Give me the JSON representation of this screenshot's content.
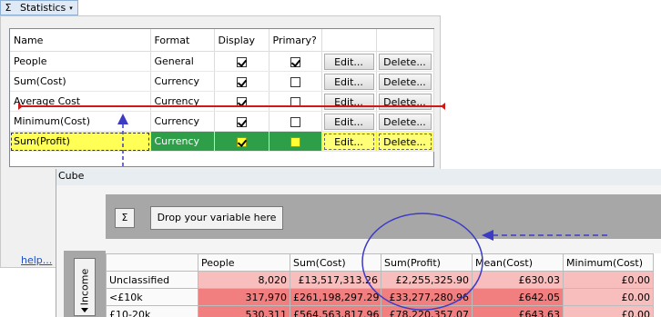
{
  "statistics_button": {
    "label": "Statistics",
    "sigma": "Σ",
    "caret": "▾"
  },
  "stats_table": {
    "headers": [
      "Name",
      "Format",
      "Display",
      "Primary?",
      "",
      ""
    ],
    "edit_label": "Edit...",
    "delete_label": "Delete...",
    "rows": [
      {
        "name": "People",
        "format": "General",
        "display": true,
        "primary": true
      },
      {
        "name": "Sum(Cost)",
        "format": "Currency",
        "display": true,
        "primary": false
      },
      {
        "name": "Average Cost",
        "format": "Currency",
        "display": true,
        "primary": false
      },
      {
        "name": "Minimum(Cost)",
        "format": "Currency",
        "display": true,
        "primary": false
      },
      {
        "name": "Sum(Profit)",
        "format": "Currency",
        "display": true,
        "primary": false,
        "highlighted": true
      }
    ]
  },
  "help_link": "help...",
  "cube": {
    "title": "Cube",
    "sigma_button": "Σ",
    "drop_button": "Drop your variable here",
    "row_variable": "Income",
    "columns": [
      "",
      "People",
      "Sum(Cost)",
      "Sum(Profit)",
      "Mean(Cost)",
      "Minimum(Cost)"
    ],
    "rows": [
      {
        "label": "Unclassified",
        "values": [
          "8,020",
          "£13,517,313.26",
          "£2,255,325.90",
          "£630.03",
          "£0.00"
        ]
      },
      {
        "label": "<£10k",
        "values": [
          "317,970",
          "£261,198,297.29",
          "£33,277,280.96",
          "£642.05",
          "£0.00"
        ]
      },
      {
        "label": "£10-20k",
        "values": [
          "530,311",
          "£564,563,817.96",
          "£78,220,357.07",
          "£643.63",
          "£0.00"
        ]
      }
    ]
  },
  "colors": {
    "highlight_yellow": "#ffff55",
    "highlight_green": "#2e9e48",
    "drop_line_red": "#d01818",
    "annotation_blue": "#3b3bc6",
    "cell_light_red": "#f8bdbd",
    "cell_red": "#f27f7f"
  }
}
